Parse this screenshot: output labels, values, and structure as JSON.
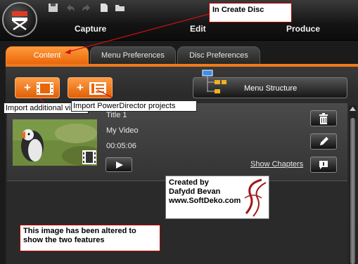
{
  "toolbar": {
    "logo_icon": "director-chair-icon",
    "quick_icons": [
      "save-icon",
      "undo-icon",
      "redo-icon",
      "new-file-icon",
      "open-folder-icon"
    ]
  },
  "nav": {
    "capture": "Capture",
    "edit": "Edit",
    "produce": "Produce"
  },
  "tabs": [
    {
      "label": "Content",
      "active": true
    },
    {
      "label": "Menu Preferences",
      "active": false
    },
    {
      "label": "Disc Preferences",
      "active": false
    }
  ],
  "content": {
    "menu_structure_label": "Menu Structure",
    "item": {
      "title": "Title 1",
      "name": "My Video",
      "duration": "00:05:06",
      "show_chapters": "Show Chapters"
    }
  },
  "annotations": {
    "create_disc": "In Create Disc",
    "import_videos": "Import additional videos",
    "import_pd": "Import PowerDirector projects",
    "credit": [
      "Created by",
      "Dafydd Bevan",
      "www.SoftDeko.com"
    ],
    "altered": "This image has been altered to show the two features"
  },
  "colors": {
    "accent_orange": "#f07a1a",
    "annotation_border": "#c00000"
  }
}
